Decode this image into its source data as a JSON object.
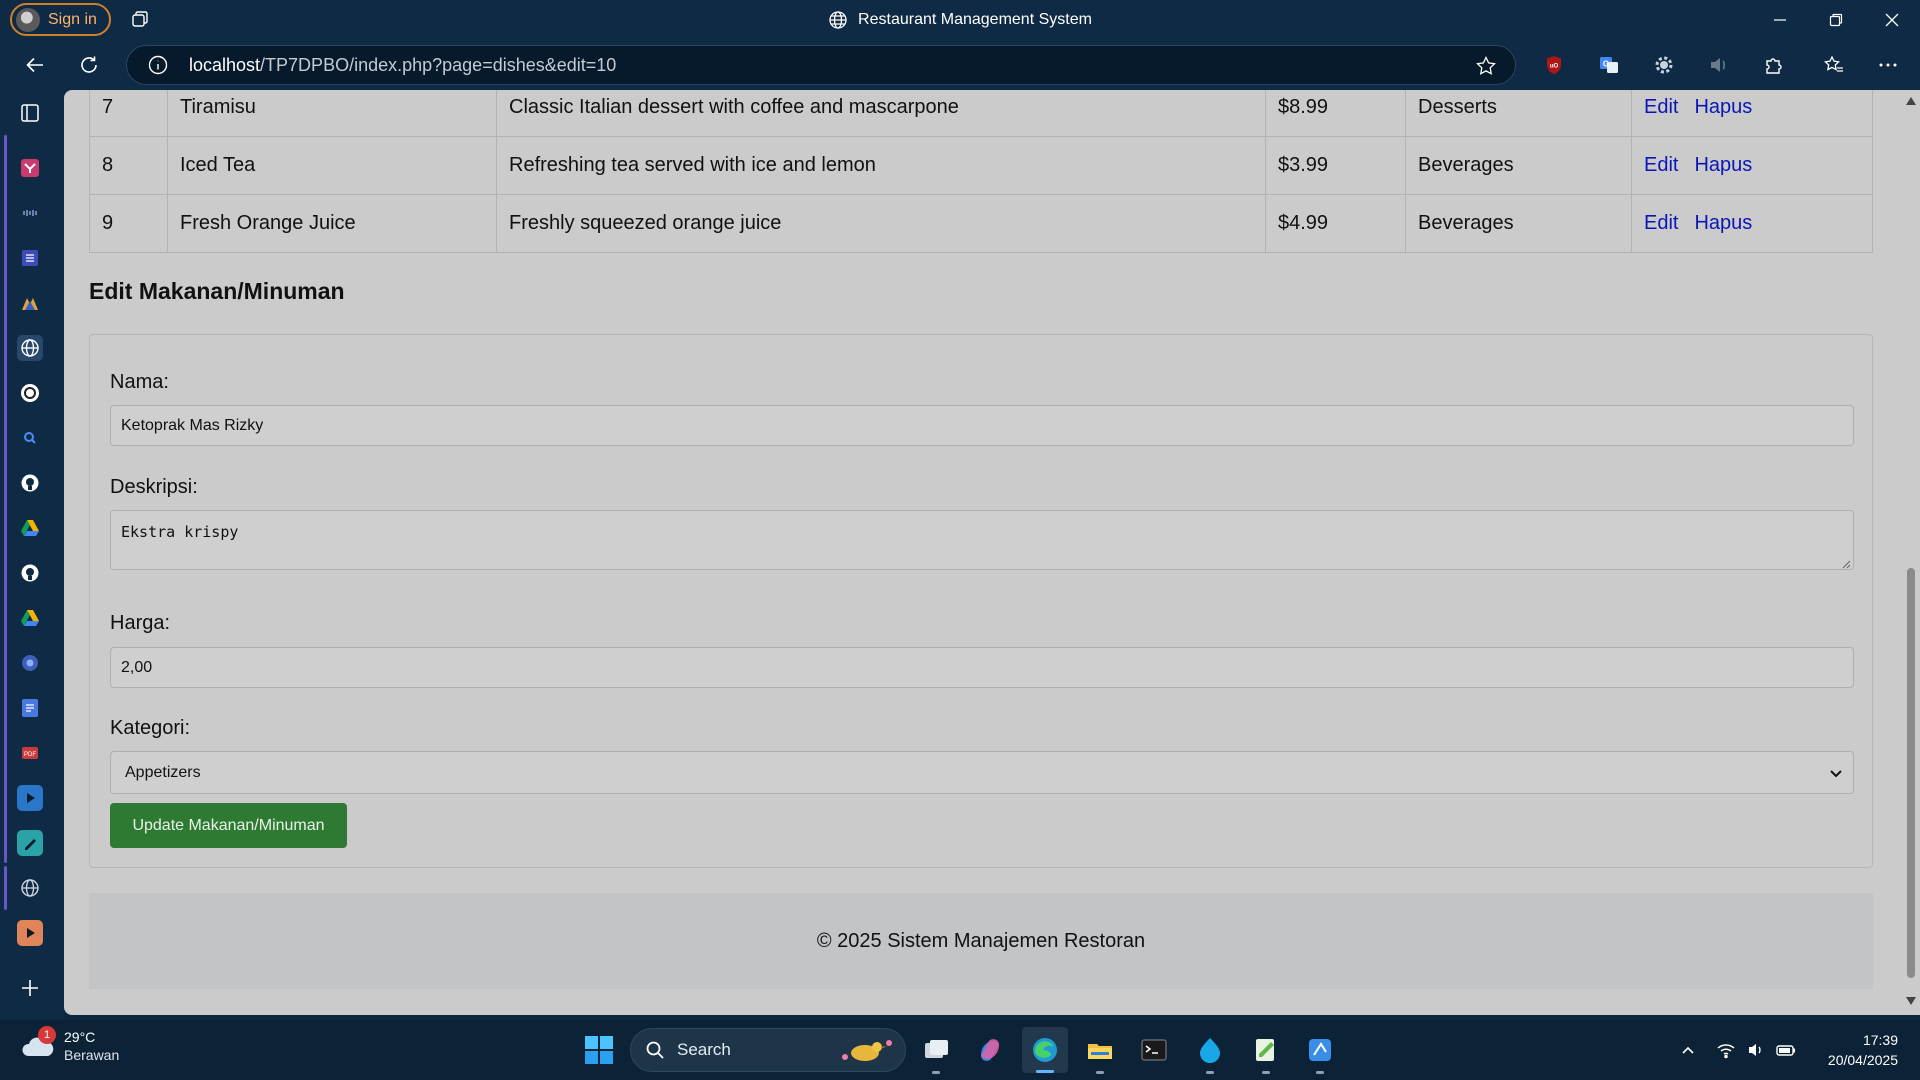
{
  "window": {
    "title": "Restaurant Management System",
    "signin_label": "Sign in"
  },
  "address_bar": {
    "url_host": "localhost",
    "url_path": "/TP7DPBO/index.php?page=dishes&edit=10"
  },
  "table": {
    "rows": [
      {
        "id": "7",
        "name": "Tiramisu",
        "description": "Classic Italian dessert with coffee and mascarpone",
        "price": "$8.99",
        "category": "Desserts",
        "edit": "Edit",
        "delete": "Hapus"
      },
      {
        "id": "8",
        "name": "Iced Tea",
        "description": "Refreshing tea served with ice and lemon",
        "price": "$3.99",
        "category": "Beverages",
        "edit": "Edit",
        "delete": "Hapus"
      },
      {
        "id": "9",
        "name": "Fresh Orange Juice",
        "description": "Freshly squeezed orange juice",
        "price": "$4.99",
        "category": "Beverages",
        "edit": "Edit",
        "delete": "Hapus"
      }
    ]
  },
  "form": {
    "title": "Edit Makanan/Minuman",
    "name_label": "Nama:",
    "name_value": "Ketoprak Mas Rizky",
    "desc_label": "Deskripsi:",
    "desc_value": "Ekstra krispy",
    "price_label": "Harga:",
    "price_value": "2,00",
    "category_label": "Kategori:",
    "category_value": "Appetizers",
    "submit_label": "Update Makanan/Minuman"
  },
  "footer": {
    "text": "© 2025 Sistem Manajemen Restoran"
  },
  "taskbar": {
    "weather_temp": "29°C",
    "weather_desc": "Berawan",
    "weather_badge": "1",
    "search_label": "Search",
    "time": "17:39",
    "date": "20/04/2025"
  },
  "colors": {
    "chrome_bg": "#0e2a44",
    "page_bg": "#cbcbcc",
    "link": "#0a17b6",
    "submit_button": "#2e7a33",
    "signin_border": "#d1802a"
  }
}
